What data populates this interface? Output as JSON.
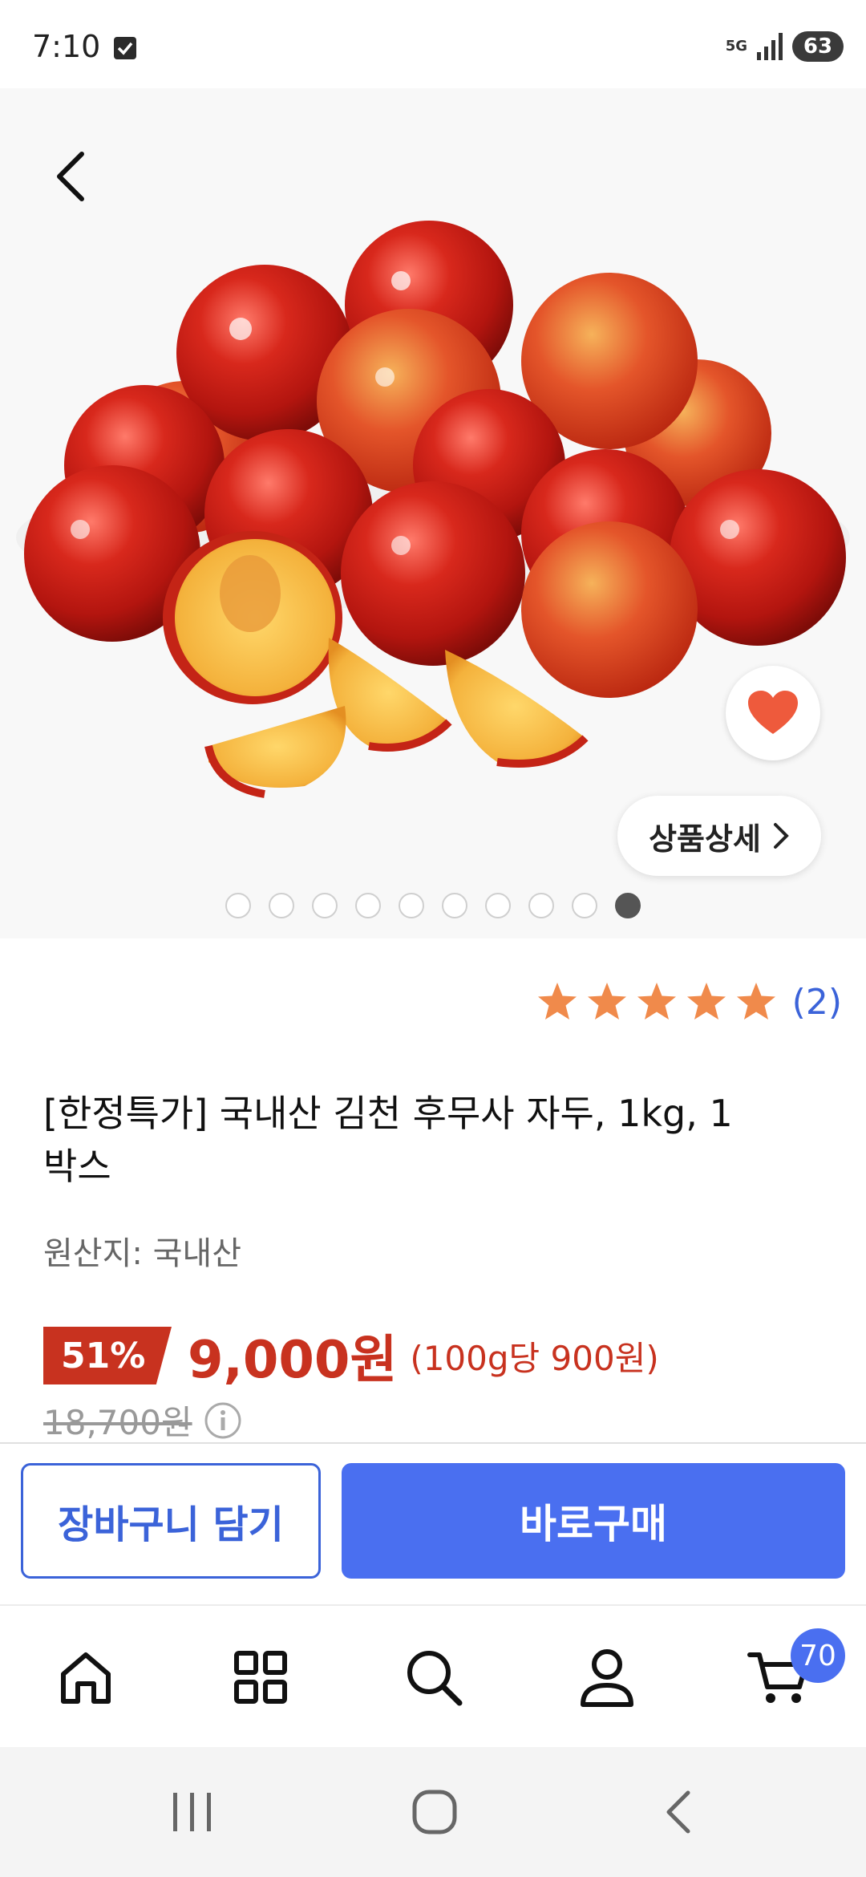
{
  "status_bar": {
    "time": "7:10",
    "network": "5G",
    "battery": "63"
  },
  "product": {
    "title": "[한정특가] 국내산 김천 후무사 자두, 1kg, 1박스",
    "origin": "원산지: 국내산",
    "rating": 5,
    "review_count": "(2)",
    "discount": "51%",
    "price": "9,000원",
    "unit_price": "(100g당 900원)",
    "original_price": "18,700원",
    "detail_button": "상품상세",
    "image_count": 10,
    "active_image_index": 9
  },
  "actions": {
    "add_to_cart": "장바구니 담기",
    "buy_now": "바로구매"
  },
  "bottom_nav": {
    "items": [
      "home-icon",
      "category-icon",
      "search-icon",
      "my-page-icon",
      "cart-icon"
    ],
    "cart_badge": "70"
  },
  "colors": {
    "accent_blue": "#4a6ff0",
    "price_red": "#c8321f",
    "star_orange": "#f08a4b"
  }
}
